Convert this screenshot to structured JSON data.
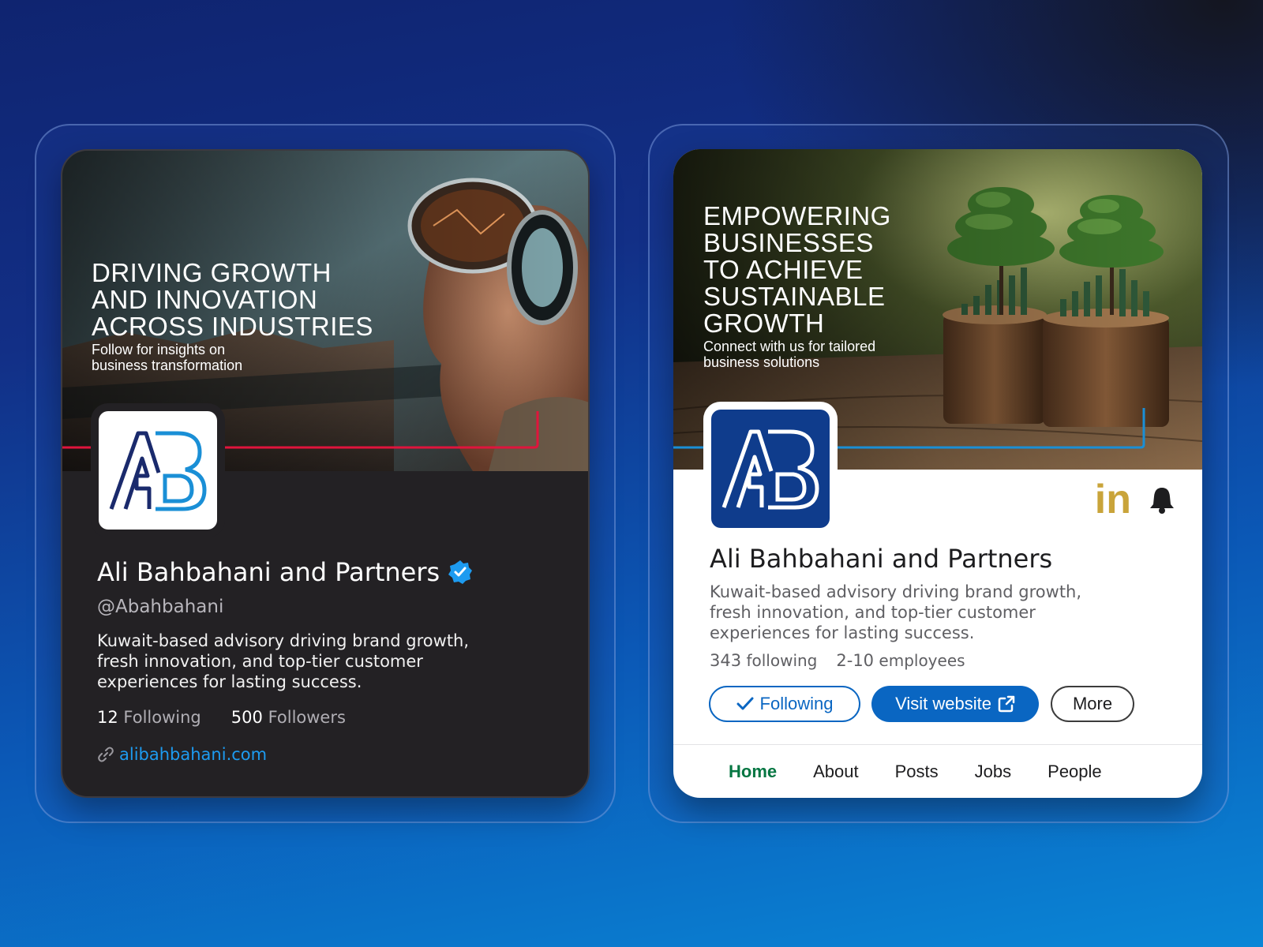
{
  "x_card": {
    "banner_title": "DRIVING GROWTH\nAND INNOVATION\nACROSS INDUSTRIES",
    "banner_subtitle": "Follow for insights on\nbusiness transformation",
    "name": "Ali Bahbahani and Partners",
    "handle": "@Abahbahani",
    "bio": "Kuwait-based advisory driving brand growth, fresh innovation, and top-tier customer experiences for lasting success.",
    "following_count": "12",
    "following_label": "Following",
    "followers_count": "500",
    "followers_label": "Followers",
    "website": "alibahbahani.com",
    "accent_color": "#1d9bf0",
    "banner_line_color": "#e0143c"
  },
  "linkedin_card": {
    "banner_title": "EMPOWERING\nBUSINESSES\nTO ACHIEVE\nSUSTAINABLE\nGROWTH",
    "banner_subtitle": "Connect with us for tailored\nbusiness solutions",
    "name": "Ali Bahbahani and Partners",
    "bio": "Kuwait-based advisory driving brand growth, fresh innovation, and top-tier customer experiences for lasting success.",
    "following_count": "343",
    "following_label": "following",
    "employees_count": "2-10",
    "employees_label": "employees",
    "brand_mark": "in",
    "buttons": {
      "following": "Following",
      "visit": "Visit website",
      "more": "More"
    },
    "tabs": [
      "Home",
      "About",
      "Posts",
      "Jobs",
      "People"
    ],
    "accent_color": "#0a66c2",
    "active_tab_color": "#057642"
  }
}
